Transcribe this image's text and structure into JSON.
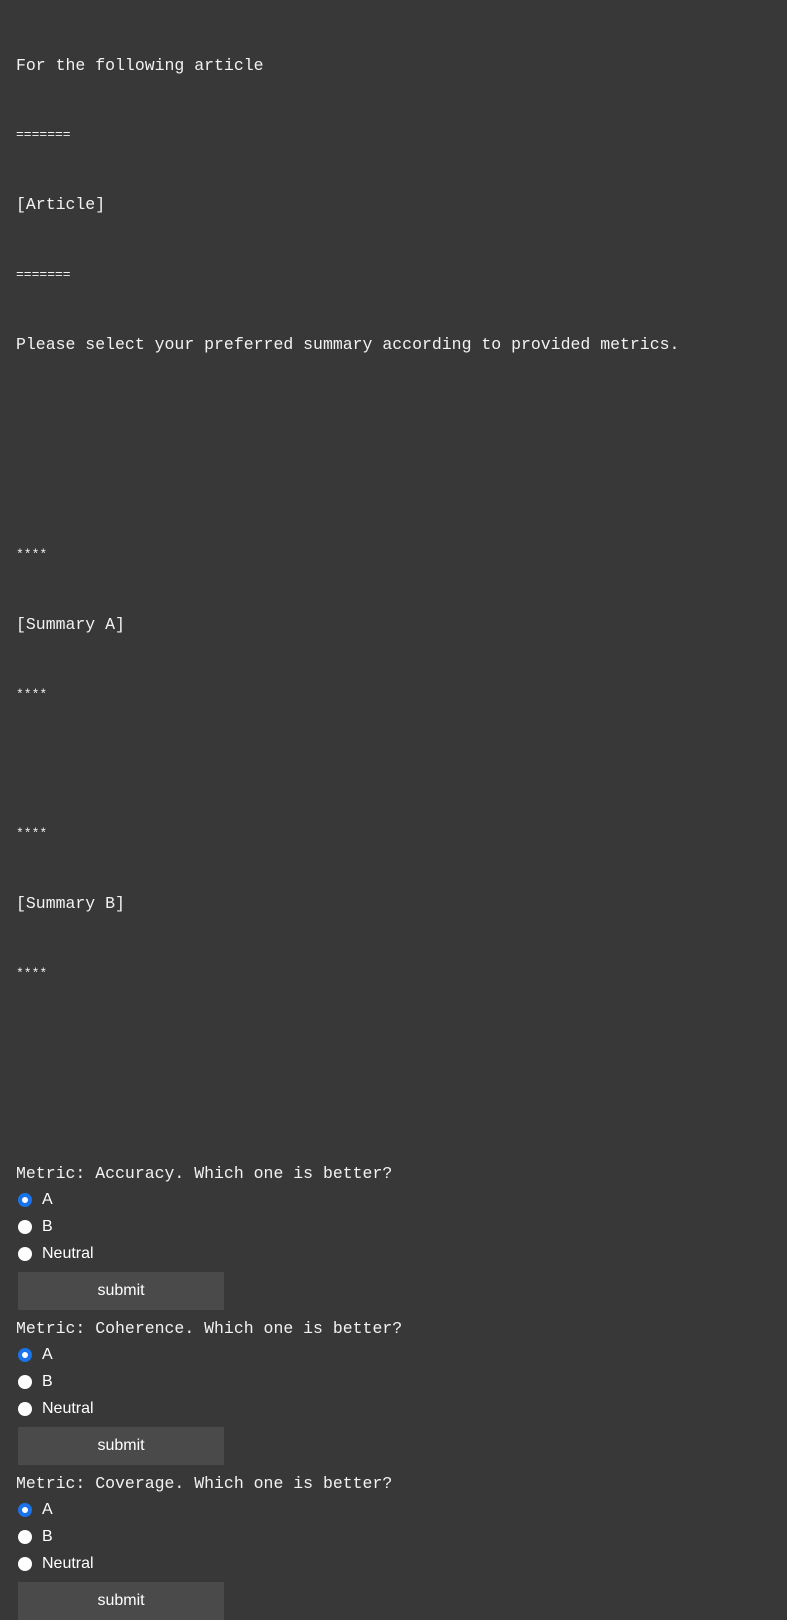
{
  "header": {
    "line1": "For the following article",
    "sep1": "=======",
    "article": "[Article]",
    "sep2": "=======",
    "instruction": "Please select your preferred summary according to provided metrics."
  },
  "summaries": {
    "a_top": "****",
    "a_label": "[Summary A]",
    "a_bottom": "****",
    "b_top": "****",
    "b_label": "[Summary B]",
    "b_bottom": "****"
  },
  "metrics": [
    {
      "question": "Metric: Accuracy. Which one is better?",
      "options": [
        "A",
        "B",
        "Neutral"
      ],
      "selected": "A",
      "submit_label": "submit"
    },
    {
      "question": "Metric: Coherence. Which one is better?",
      "options": [
        "A",
        "B",
        "Neutral"
      ],
      "selected": "A",
      "submit_label": "submit"
    },
    {
      "question": "Metric: Coverage. Which one is better?",
      "options": [
        "A",
        "B",
        "Neutral"
      ],
      "selected": "A",
      "submit_label": "submit"
    }
  ],
  "colors": {
    "background": "#383838",
    "button": "#4a4a4a",
    "radio_accent": "#1a73e8"
  }
}
